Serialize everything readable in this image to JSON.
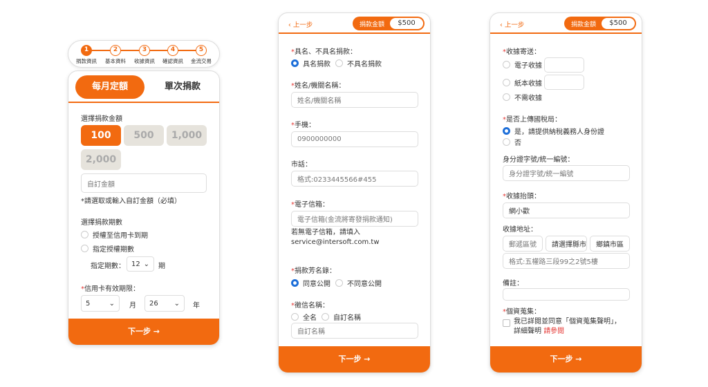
{
  "steps": [
    "捐款資訊",
    "基本資料",
    "收據資訊",
    "確認資訊",
    "金流交易"
  ],
  "step_numbers": [
    "1",
    "2",
    "3",
    "4",
    "5"
  ],
  "p1": {
    "tab_monthly": "每月定額",
    "tab_single": "單次捐款",
    "choose_amount": "選擇捐款金額",
    "amounts": [
      "100",
      "500",
      "1,000",
      "2,000"
    ],
    "custom_placeholder": "自訂金額",
    "error": "*請選取或輸入自訂金額（必填）",
    "period_label": "選擇捐款期數",
    "opt1": "授權至信用卡到期",
    "opt2": "指定授權期數",
    "period_prefix": "指定期數：",
    "period_value": "12",
    "period_unit": "期",
    "expiry_label": "信用卡有效期限：",
    "month_value": "5",
    "month_unit": "月",
    "year_value": "26",
    "year_unit": "年",
    "next": "下一步 →"
  },
  "p2": {
    "back": "上一步",
    "amount_label": "捐款金額",
    "amount_value": "$500",
    "q_named": "具名、不具名捐款：",
    "named": "具名捐款",
    "anonymous": "不具名捐款",
    "q_name": "姓名/機關名稱：",
    "name_placeholder": "姓名/機關名稱",
    "q_mobile": "手機：",
    "mobile_placeholder": "0900000000",
    "q_phone": "市話：",
    "phone_placeholder": "格式:0233445566#455",
    "q_email": "電子信箱：",
    "email_placeholder": "電子信箱(金流將寄發捐款通知)",
    "email_note_1": "若無電子信箱，請填入",
    "email_note_2": "service@intersoft.com.tw",
    "q_list": "捐款芳名錄：",
    "agree_public": "同意公開",
    "disagree_public": "不同意公開",
    "q_sign": "徵信名稱：",
    "fullname": "全名",
    "custom_name": "自訂名稱",
    "custom_name_placeholder": "自訂名稱",
    "next": "下一步 →"
  },
  "p3": {
    "back": "上一步",
    "amount_label": "捐款金額",
    "amount_value": "$500",
    "q_receipt_send": "收據寄送：",
    "e_receipt": "電子收據",
    "paper_receipt": "紙本收據",
    "no_receipt": "不需收據",
    "q_upload": "是否上傳國稅局：",
    "yes_upload": "是，請提供納稅義務人身份證",
    "no_upload": "否",
    "q_id": "身分證字號/統一編號：",
    "id_placeholder": "身分證字號/統一編號",
    "q_title": "收據抬頭：",
    "title_value": "網小歡",
    "q_address": "收據地址：",
    "zip_placeholder": "郵遞區號",
    "county_placeholder": "請選擇縣市",
    "town_placeholder": "鄉鎮市區",
    "address_placeholder": "格式:五權路三段99之2號5樓",
    "q_note": "備註：",
    "q_privacy": "個資蒐集：",
    "privacy_text": "我已詳閱並同意「個資蒐集聲明」，",
    "privacy_more": "詳細聲明",
    "privacy_link": "請參閱",
    "next": "下一步 →"
  }
}
